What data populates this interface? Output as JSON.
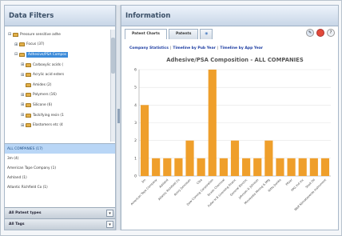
{
  "left_panel": {
    "title": "Data Filters",
    "tree": [
      {
        "label": "Pressure sensitive adhe",
        "toggle": "⊟",
        "indent": 0,
        "selected": false
      },
      {
        "label": "Focus (37)",
        "toggle": "⊞",
        "indent": 1,
        "selected": false
      },
      {
        "label": "Adhesive/PSA Compos",
        "toggle": "⊟",
        "indent": 1,
        "selected": true
      },
      {
        "label": "Carboxylic acids (",
        "toggle": "⊞",
        "indent": 2,
        "selected": false
      },
      {
        "label": "Acrylic acid esters",
        "toggle": "⊞",
        "indent": 2,
        "selected": false
      },
      {
        "label": "Amides (2)",
        "toggle": "",
        "indent": 2,
        "selected": false
      },
      {
        "label": "Polymers (16)",
        "toggle": "⊞",
        "indent": 2,
        "selected": false
      },
      {
        "label": "Silicone (6)",
        "toggle": "⊞",
        "indent": 2,
        "selected": false
      },
      {
        "label": "Tackifying resin (1",
        "toggle": "⊞",
        "indent": 2,
        "selected": false
      },
      {
        "label": "Elastomers etc (4",
        "toggle": "⊞",
        "indent": 2,
        "selected": false
      }
    ],
    "list": [
      {
        "label": "ALL COMPANIES (17)",
        "selected": true
      },
      {
        "label": "3m (4)",
        "selected": false
      },
      {
        "label": "American Tape Company (1)",
        "selected": false
      },
      {
        "label": "Ashland (1)",
        "selected": false
      },
      {
        "label": "Atlantic Richfield Co (1)",
        "selected": false
      }
    ],
    "dropdown_types": "All Patent types",
    "dropdown_tags": "All Tags"
  },
  "right_panel": {
    "title": "Information",
    "tabs": [
      "Patent Charts",
      "Patents"
    ],
    "stats_label": "Company Statistics",
    "stats_link1": "Timeline by Pub Year",
    "stats_link2": "Timeline by App Year"
  },
  "chart_data": {
    "type": "bar",
    "title": "Adhesive/PSA Composition - ALL COMPANIES",
    "ylim": [
      0,
      6
    ],
    "yticks": [
      0,
      1,
      2,
      3,
      4,
      5,
      6
    ],
    "grid": true,
    "bar_color": "#ef9f2b",
    "categories": [
      "3m",
      "American Tape Company",
      "Ashland",
      "Atlantic Richfield Co",
      "Avery Dennison",
      "Ciba",
      "Dow Corning Corporation",
      "Exxon Chemical",
      "Fuller H B Licensing Financ",
      "General Electric",
      "Johnson & Johnson",
      "Minnesota Mining & Mfg",
      "Nitto Denko",
      "Pfizer",
      "PPG Ind Inc",
      "Shell Oil",
      "Wolf Klimatiseerde Instrument"
    ],
    "values": [
      4,
      1,
      1,
      1,
      2,
      1,
      6,
      1,
      2,
      1,
      1,
      2,
      1,
      1,
      1,
      1,
      1
    ]
  }
}
